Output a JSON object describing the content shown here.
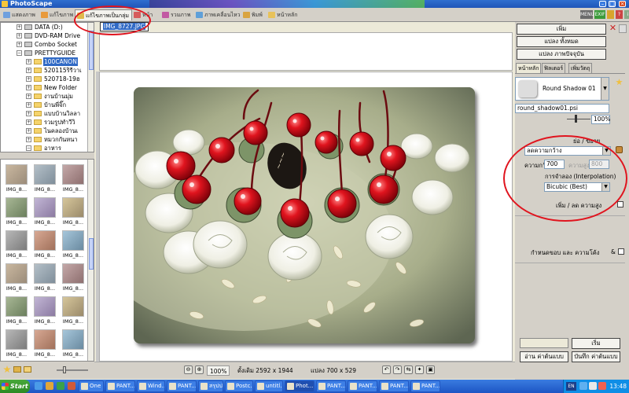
{
  "window": {
    "title": "PhotoScape"
  },
  "tabs": [
    {
      "label": "แสดงภาพ",
      "active": false
    },
    {
      "label": "แก้ไขภาพ",
      "active": false
    },
    {
      "label": "แก้ไขภาพเป็นกลุ่ม",
      "active": true
    },
    {
      "label": "หน้า",
      "active": false
    },
    {
      "label": "รวมภาพ",
      "active": false
    },
    {
      "label": "ภาพเคลื่อนไหว",
      "active": false
    },
    {
      "label": "พิมพ์",
      "active": false
    },
    {
      "label": "หน้าหลัก",
      "active": false
    }
  ],
  "toolbar_right": {
    "menu": "MENU",
    "exif": "EXIF"
  },
  "folder_tree": [
    {
      "label": "DATA (D:)",
      "icon": "drive"
    },
    {
      "label": "DVD-RAM Drive",
      "icon": "drive"
    },
    {
      "label": "Combo Socket",
      "icon": "drive"
    },
    {
      "label": "PRETTYGUIDE",
      "icon": "drive"
    },
    {
      "label": "100CANON",
      "icon": "folder",
      "selected": true
    },
    {
      "label": "520115ริรีวาเ",
      "icon": "folder"
    },
    {
      "label": "520718-19ฮ",
      "icon": "folder"
    },
    {
      "label": "New Folder",
      "icon": "folder"
    },
    {
      "label": "งานบ้านมุ่ม",
      "icon": "folder"
    },
    {
      "label": "บ้านพี่จิ๊ก",
      "icon": "folder"
    },
    {
      "label": "แบบบ้านวิลลา",
      "icon": "folder"
    },
    {
      "label": "รวมรูปทำวีวิ",
      "icon": "folder"
    },
    {
      "label": "ไนคลองบ้านเ",
      "icon": "folder"
    },
    {
      "label": "หมวกกันหนา",
      "icon": "folder"
    },
    {
      "label": "อาหาร",
      "icon": "folder"
    },
    {
      "label": "Originals",
      "icon": "folder"
    },
    {
      "label": "Control Panel",
      "icon": "drive"
    }
  ],
  "thumbnails": [
    "IMG_8...",
    "IMG_8...",
    "IMG_8...",
    "IMG_8...",
    "IMG_8...",
    "IMG_8...",
    "IMG_8...",
    "IMG_8...",
    "IMG_8...",
    "IMG_8...",
    "IMG_8...",
    "IMG_8...",
    "IMG_8...",
    "IMG_8...",
    "IMG_8...",
    "IMG_8...",
    "IMG_8...",
    "IMG_8..."
  ],
  "document": {
    "filename": "IMG_8727.JPG"
  },
  "status": {
    "zoom": "100%",
    "original_size": "ดั้งเดิม 2592 x 1944",
    "converted_size": "แปลง 700 x 529"
  },
  "right_panel": {
    "add_button": "เพิ่ม",
    "convert_all_button": "แปลง ทั้งหมด",
    "convert_current_button": "แปลง ภาพปัจจุบัน",
    "tabs": [
      "หน้าหลัก",
      "ฟิลเตอร์",
      "เพิ่มวัตถุ"
    ],
    "frame_name": "Round Shadow 01",
    "frame_file": "round_shadow01.psi",
    "frame_zoom": "100%",
    "resize_label": "ย่อ / ขยาย",
    "resize_mode": "ลดความกว้าง",
    "width_label": "ความกว้าง",
    "width_value": "700",
    "height_label": "ความสูง",
    "height_value": "800",
    "interp_label": "การจำลอง (Interpolation)",
    "interp_value": "Bicubic (Best)",
    "add_reduce_height_label": "เพิ่ม / ลด ความสูง",
    "border_label": "กำหนดขอบ และ ความโค้ง",
    "border_amp": "&",
    "start_button": "เริ่ม",
    "load_settings_button": "อ่าน ค่าต้นแบบ",
    "save_settings_button": "บันทึก ค่าต้นแบบ"
  },
  "taskbar": {
    "start": "Start",
    "buttons": [
      {
        "label": "One ..."
      },
      {
        "label": "PANT..."
      },
      {
        "label": "Wind..."
      },
      {
        "label": "PANT..."
      },
      {
        "label": "สรุปป..."
      },
      {
        "label": "Postc..."
      },
      {
        "label": "untitl..."
      },
      {
        "label": "Phot...",
        "active": true
      },
      {
        "label": "PANT..."
      },
      {
        "label": "PANT..."
      },
      {
        "label": "PANT..."
      },
      {
        "label": "PANT..."
      }
    ],
    "lang": "EN",
    "clock": "13:48"
  },
  "colors": {
    "annotation_red": "#e0141e",
    "selection_blue": "#316ac5",
    "taskbar_blue": "#245edb"
  }
}
